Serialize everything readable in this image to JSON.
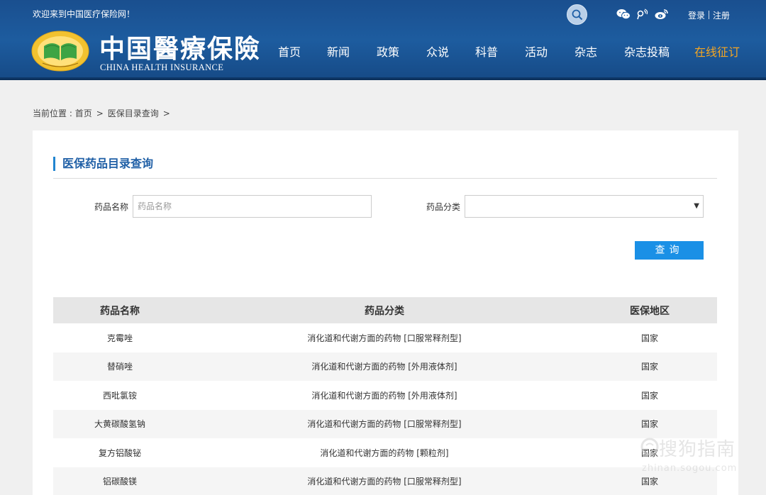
{
  "header": {
    "welcome": "欢迎来到中国医疗保险网！",
    "logo_cn": "中国醫療保險",
    "logo_en": "CHINA HEALTH INSURANCE",
    "login": "登录",
    "register": "注册",
    "nav": [
      "首页",
      "新闻",
      "政策",
      "众说",
      "科普",
      "活动",
      "杂志",
      "杂志投稿",
      "在线征订"
    ],
    "accent_color": "#f5a623",
    "bg_color": "#1d5c9f"
  },
  "breadcrumb": {
    "prefix": "当前位置 : ",
    "home": "首页",
    "sep": ">",
    "current": "医保目录查询",
    "trail": ">"
  },
  "panel": {
    "title": "医保药品目录查询",
    "name_label": "药品名称",
    "name_placeholder": "药品名称",
    "category_label": "药品分类",
    "category_value": "",
    "query_button": "查询",
    "button_color": "#1a90e6"
  },
  "table": {
    "headers": [
      "药品名称",
      "药品分类",
      "医保地区"
    ],
    "rows": [
      [
        "克霉唑",
        "消化道和代谢方面的药物 [口服常释剂型]",
        "国家"
      ],
      [
        "替硝唑",
        "消化道和代谢方面的药物 [外用液体剂]",
        "国家"
      ],
      [
        "西吡氯铵",
        "消化道和代谢方面的药物 [外用液体剂]",
        "国家"
      ],
      [
        "大黄碳酸氢钠",
        "消化道和代谢方面的药物 [口服常释剂型]",
        "国家"
      ],
      [
        "复方铝酸铋",
        "消化道和代谢方面的药物 [颗粒剂]",
        "国家"
      ],
      [
        "铝碳酸镁",
        "消化道和代谢方面的药物 [口服常释剂型]",
        "国家"
      ]
    ]
  },
  "watermark": {
    "cn": "搜狗指南",
    "en": "zhinan.sogou.com"
  }
}
